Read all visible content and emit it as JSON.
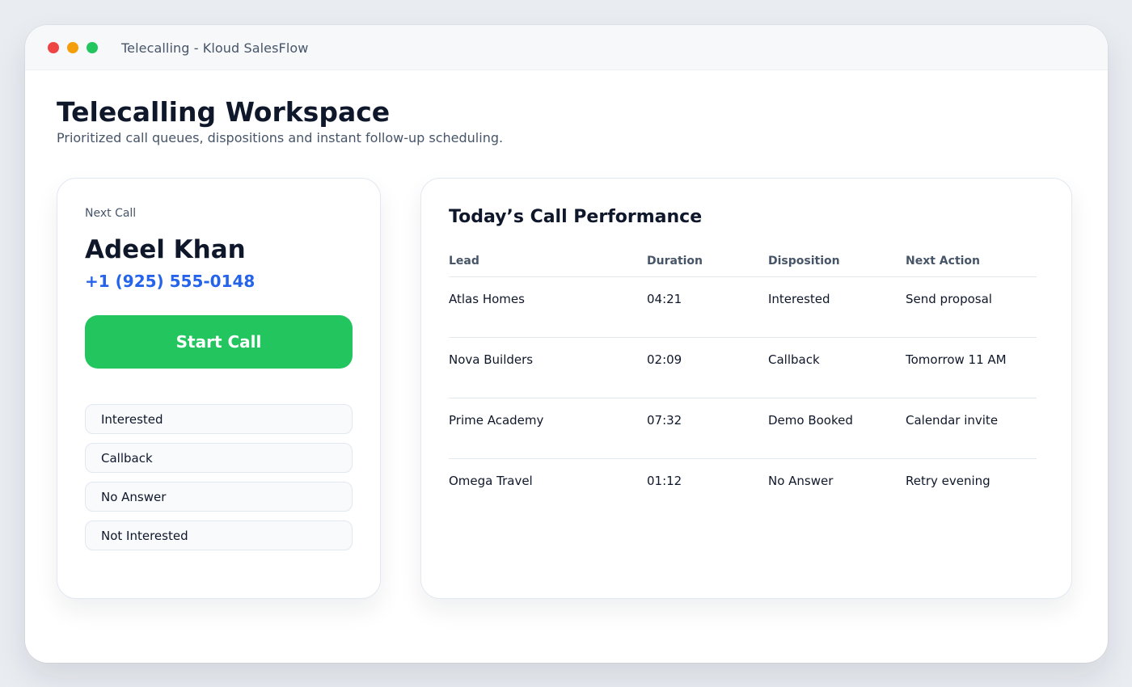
{
  "window": {
    "title": "Telecalling - Kloud SalesFlow"
  },
  "page": {
    "title": "Telecalling Workspace",
    "subtitle": "Prioritized call queues, dispositions and instant follow-up scheduling."
  },
  "next_call": {
    "label": "Next Call",
    "name": "Adeel Khan",
    "phone": "+1 (925) 555-0148",
    "start_button": "Start Call",
    "dispositions": [
      "Interested",
      "Callback",
      "No Answer",
      "Not Interested"
    ]
  },
  "performance": {
    "title": "Today’s Call Performance",
    "columns": [
      "Lead",
      "Duration",
      "Disposition",
      "Next Action"
    ],
    "rows": [
      [
        "Atlas Homes",
        "04:21",
        "Interested",
        "Send proposal"
      ],
      [
        "Nova Builders",
        "02:09",
        "Callback",
        "Tomorrow 11 AM"
      ],
      [
        "Prime Academy",
        "07:32",
        "Demo Booked",
        "Calendar invite"
      ],
      [
        "Omega Travel",
        "01:12",
        "No Answer",
        "Retry evening"
      ]
    ]
  },
  "colors": {
    "accent_green": "#22c55e",
    "phone_blue": "#2563eb",
    "close": "#ef4444",
    "minimize": "#f59e0b",
    "maximize": "#22c55e"
  }
}
